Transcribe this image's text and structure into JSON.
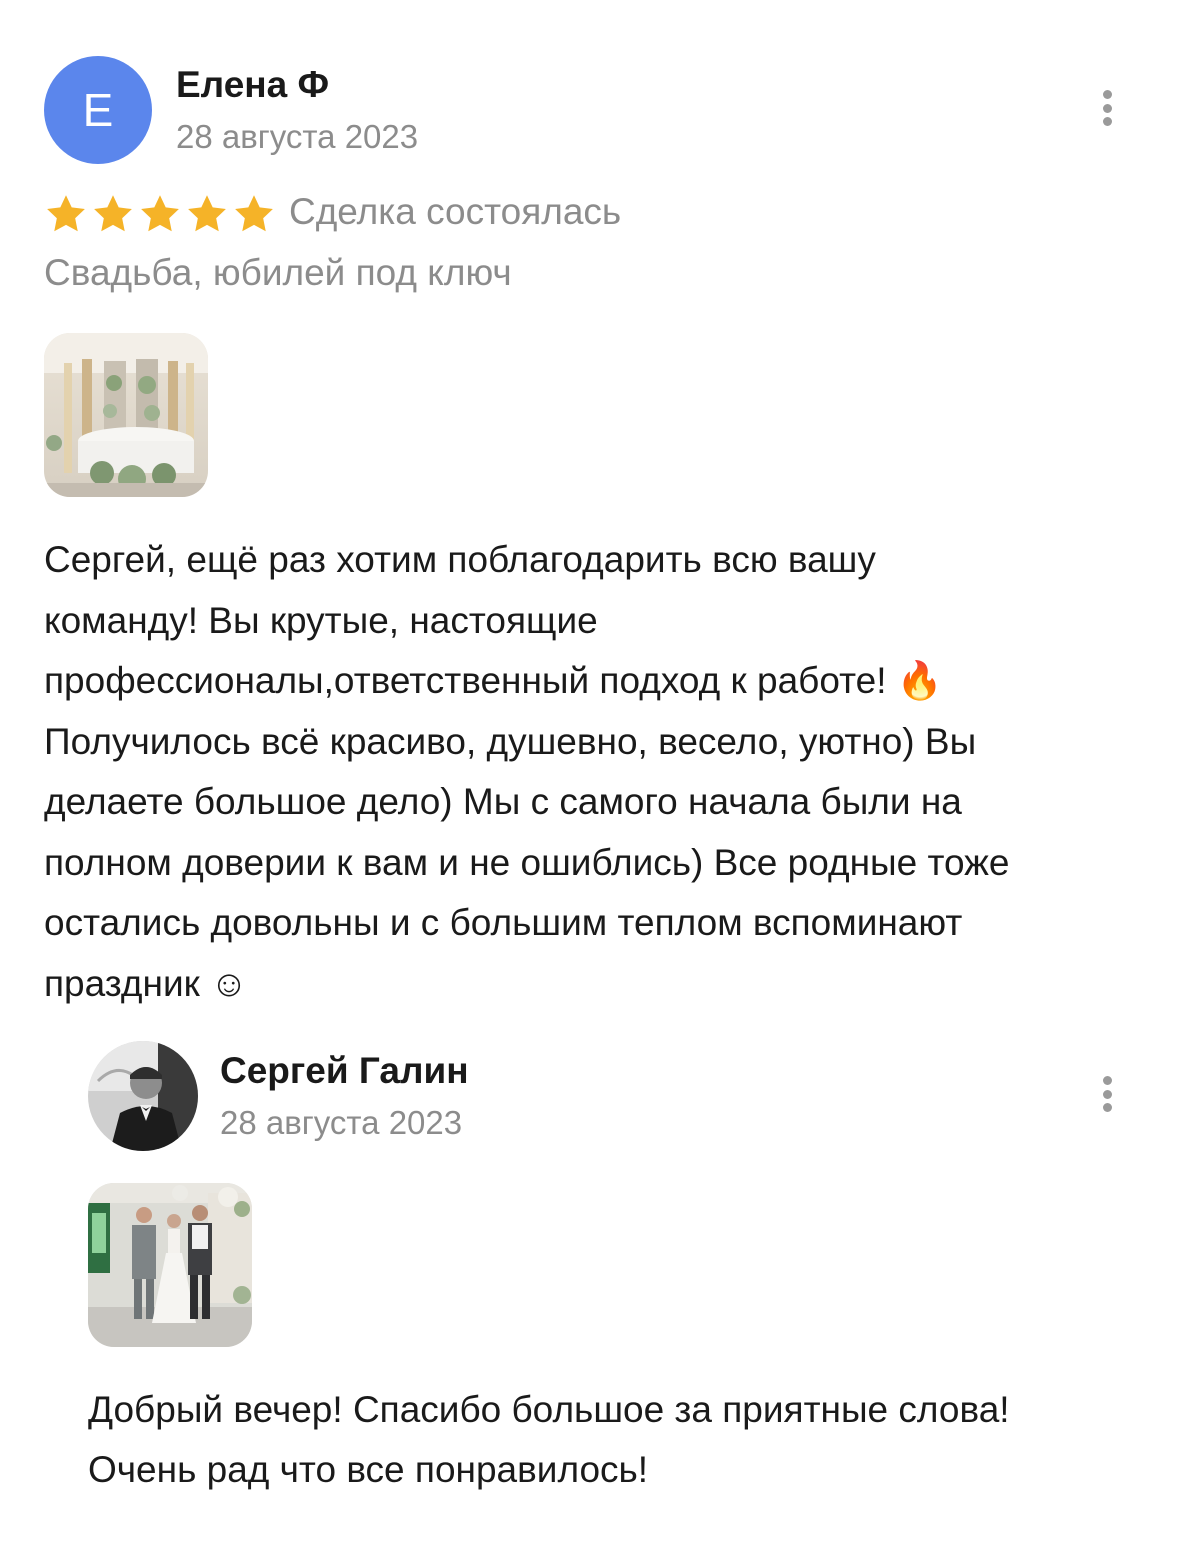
{
  "review": {
    "avatar_letter": "Е",
    "author": "Елена Ф",
    "date": "28 августа 2023",
    "rating": 5,
    "deal_status": "Сделка состоялась",
    "service": "Свадьба, юбилей под ключ",
    "text": "Сергей, ещё раз хотим поблагодарить всю вашу\nкоманду! Вы крутые, настоящие\nпрофессионалы,ответственный подход к работе! 🔥\nПолучилось всё красиво, душевно, весело, уютно) Вы\nделаете большое дело) Мы с самого начала были на\nполном доверии к вам и не ошиблись) Все родные тоже\nостались довольны и с большим теплом вспоминают\nпраздник ☺"
  },
  "reply": {
    "author": "Сергей Галин",
    "date": "28 августа 2023",
    "text": "Добрый вечер! Спасибо большое за приятные слова!\nОчень рад что все понравилось!"
  },
  "icons": {
    "star": "star-icon",
    "more": "more-vertical-icon"
  },
  "colors": {
    "avatar_bg": "#5b86ec",
    "star": "#f5b328",
    "secondary_text": "#8c8c8c",
    "primary_text": "#1a1a1a"
  }
}
